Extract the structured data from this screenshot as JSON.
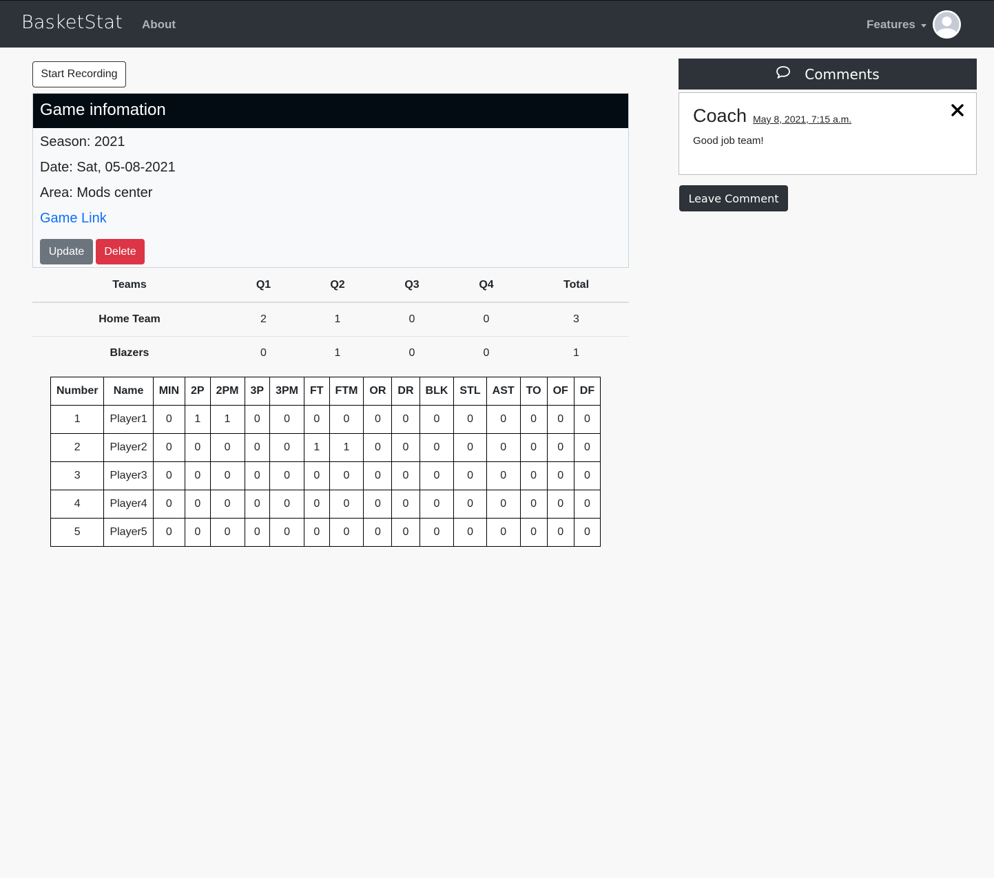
{
  "navbar": {
    "brand": "BasketStat",
    "about": "About",
    "features": "Features",
    "avatar_icon": "user-avatar-icon"
  },
  "start_recording": "Start Recording",
  "game_info": {
    "title": "Game infomation",
    "season": "Season: 2021",
    "date": "Date: Sat, 05-08-2021",
    "area": "Area: Mods center",
    "link": "Game Link",
    "update": "Update",
    "delete": "Delete"
  },
  "score": {
    "headers": [
      "Teams",
      "Q1",
      "Q2",
      "Q3",
      "Q4",
      "Total"
    ],
    "rows": [
      [
        "Home Team",
        "2",
        "1",
        "0",
        "0",
        "3"
      ],
      [
        "Blazers",
        "0",
        "1",
        "0",
        "0",
        "1"
      ]
    ]
  },
  "stats": {
    "headers": [
      "Number",
      "Name",
      "MIN",
      "2P",
      "2PM",
      "3P",
      "3PM",
      "FT",
      "FTM",
      "OR",
      "DR",
      "BLK",
      "STL",
      "AST",
      "TO",
      "OF",
      "DF"
    ],
    "rows": [
      [
        "1",
        "Player1",
        "0",
        "1",
        "1",
        "0",
        "0",
        "0",
        "0",
        "0",
        "0",
        "0",
        "0",
        "0",
        "0",
        "0",
        "0"
      ],
      [
        "2",
        "Player2",
        "0",
        "0",
        "0",
        "0",
        "0",
        "1",
        "1",
        "0",
        "0",
        "0",
        "0",
        "0",
        "0",
        "0",
        "0"
      ],
      [
        "3",
        "Player3",
        "0",
        "0",
        "0",
        "0",
        "0",
        "0",
        "0",
        "0",
        "0",
        "0",
        "0",
        "0",
        "0",
        "0",
        "0"
      ],
      [
        "4",
        "Player4",
        "0",
        "0",
        "0",
        "0",
        "0",
        "0",
        "0",
        "0",
        "0",
        "0",
        "0",
        "0",
        "0",
        "0",
        "0"
      ],
      [
        "5",
        "Player5",
        "0",
        "0",
        "0",
        "0",
        "0",
        "0",
        "0",
        "0",
        "0",
        "0",
        "0",
        "0",
        "0",
        "0",
        "0"
      ]
    ]
  },
  "comments": {
    "title": "Comments",
    "icon": "comment-bubble-icon",
    "items": [
      {
        "author": "Coach",
        "date": "May 8, 2021, 7:15 a.m.",
        "text": "Good job team!"
      }
    ],
    "leave": "Leave Comment"
  }
}
